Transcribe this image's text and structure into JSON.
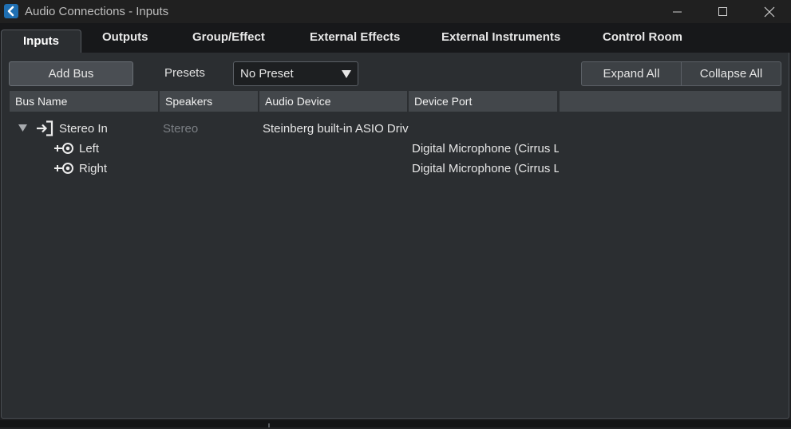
{
  "window": {
    "title": "Audio Connections - Inputs",
    "accent_color": "#1f6fb2",
    "controls": [
      "minimize-icon",
      "maximize-icon",
      "close-icon"
    ]
  },
  "tabs": [
    {
      "label": "Inputs",
      "active": true
    },
    {
      "label": "Outputs"
    },
    {
      "label": "Group/Effect"
    },
    {
      "label": "External Effects"
    },
    {
      "label": "External Instruments"
    },
    {
      "label": "Control Room"
    }
  ],
  "toolbar": {
    "add_bus_label": "Add Bus",
    "presets_label": "Presets",
    "preset_value": "No Preset",
    "expand_all_label": "Expand All",
    "collapse_all_label": "Collapse All"
  },
  "table": {
    "columns": [
      "Bus Name",
      "Speakers",
      "Audio Device",
      "Device Port",
      ""
    ],
    "rows": [
      {
        "bus_name": "Stereo In",
        "speakers": "Stereo",
        "audio_device": "Steinberg built-in ASIO Driv",
        "device_port": "",
        "expanded": true,
        "children": [
          {
            "bus_name": "Left",
            "device_port": "Digital Microphone (Cirrus L"
          },
          {
            "bus_name": "Right",
            "device_port": "Digital Microphone (Cirrus L"
          }
        ]
      }
    ]
  }
}
